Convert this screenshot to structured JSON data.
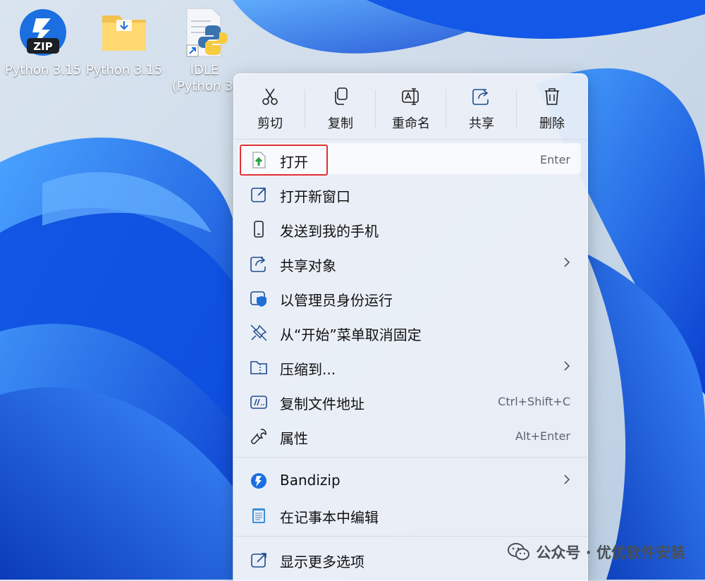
{
  "desktop": {
    "icons": [
      {
        "label": "Python 3.15",
        "icon": "bandizip-zip-icon"
      },
      {
        "label": "Python 3.15",
        "icon": "folder-icon"
      },
      {
        "label": "IDLE",
        "label2": "(Python 3.",
        "icon": "python-shortcut-icon"
      }
    ]
  },
  "menu": {
    "toolbar": [
      {
        "label": "剪切",
        "icon": "scissors-icon"
      },
      {
        "label": "复制",
        "icon": "copy-icon"
      },
      {
        "label": "重命名",
        "icon": "rename-icon"
      },
      {
        "label": "共享",
        "icon": "share-icon"
      },
      {
        "label": "删除",
        "icon": "trash-icon"
      }
    ],
    "items": [
      {
        "label": "打开",
        "shortcut": "Enter",
        "icon": "open-file-icon"
      },
      {
        "label": "打开新窗口",
        "icon": "open-new-window-icon"
      },
      {
        "label": "发送到我的手机",
        "icon": "phone-icon"
      },
      {
        "label": "共享对象",
        "icon": "share-icon",
        "submenu": true
      },
      {
        "label": "以管理员身份运行",
        "icon": "shield-icon"
      },
      {
        "label": "从“开始”菜单取消固定",
        "icon": "unpin-icon"
      },
      {
        "label": "压缩到...",
        "icon": "compress-icon",
        "submenu": true
      },
      {
        "label": "复制文件地址",
        "shortcut": "Ctrl+Shift+C",
        "icon": "copy-path-icon"
      },
      {
        "label": "属性",
        "shortcut": "Alt+Enter",
        "icon": "wrench-icon"
      },
      {
        "label": "Bandizip",
        "icon": "bandizip-icon",
        "submenu": true
      },
      {
        "label": "在记事本中编辑",
        "icon": "notepad-icon"
      },
      {
        "label": "显示更多选项",
        "icon": "more-options-icon"
      }
    ]
  },
  "watermark": {
    "text": "公众号 · 优优软件安装"
  },
  "colors": {
    "highlight_box": "#e03131",
    "accent": "#0f6cbd"
  }
}
